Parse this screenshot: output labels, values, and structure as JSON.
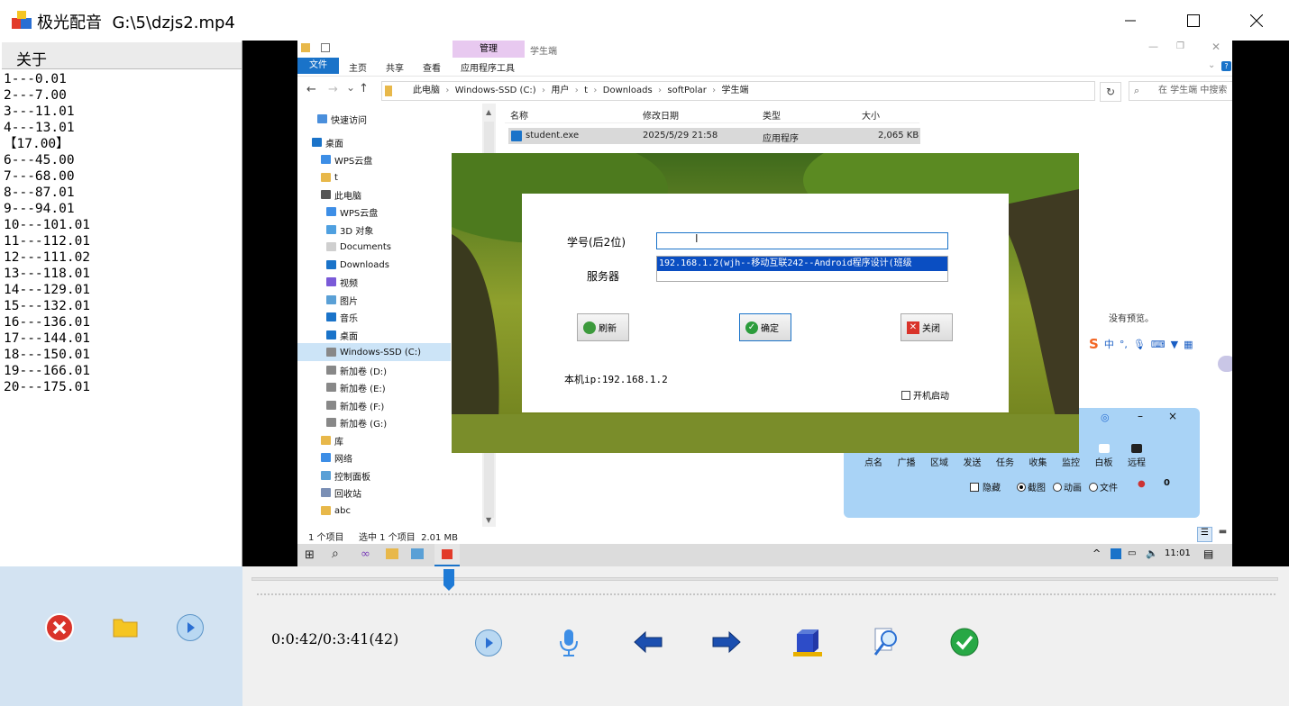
{
  "window": {
    "title": "极光配音  G:\\5\\dzjs2.mp4"
  },
  "menu": {
    "about": "关于"
  },
  "segments": [
    "1---0.01",
    "2---7.00",
    "3---11.01",
    "4---13.01",
    "【17.00】",
    "6---45.00",
    "7---68.00",
    "8---87.01",
    "9---94.01",
    "10---101.01",
    "11---112.01",
    "12---111.02",
    "13---118.01",
    "14---129.01",
    "15---132.01",
    "16---136.01",
    "17---144.01",
    "18---150.01",
    "19---166.01",
    "20---175.01"
  ],
  "explorer": {
    "ribbon": {
      "manage": "管理",
      "context_title": "学生端",
      "file": "文件",
      "home": "主页",
      "share": "共享",
      "view": "查看",
      "app_tools": "应用程序工具"
    },
    "path": [
      "此电脑",
      "Windows-SSD (C:)",
      "用户",
      "t",
      "Downloads",
      "softPolar",
      "学生端"
    ],
    "search_placeholder": "在 学生端 中搜索",
    "nav": [
      "快速访问",
      "桌面",
      "WPS云盘",
      "t",
      "此电脑",
      "WPS云盘",
      "3D 对象",
      "Documents",
      "Downloads",
      "视频",
      "图片",
      "音乐",
      "桌面",
      "Windows-SSD (C:)",
      "新加卷 (D:)",
      "新加卷 (E:)",
      "新加卷 (F:)",
      "新加卷 (G:)",
      "库",
      "网络",
      "控制面板",
      "回收站",
      "abc"
    ],
    "columns": [
      "名称",
      "修改日期",
      "类型",
      "大小"
    ],
    "files": [
      {
        "name": "student.exe",
        "date": "2025/5/29 21:58",
        "type": "应用程序",
        "size": "2,065 KB"
      }
    ],
    "status_count": "1 个项目",
    "status_selected": "选中 1 个项目  2.01 MB",
    "no_preview": "没有预览。"
  },
  "login_dialog": {
    "id_label": "学号(后2位)",
    "id_value": "",
    "server_label": "服务器",
    "server_value": "192.168.1.2(wjh--移动互联242--Android程序设计(班级",
    "refresh": "刷新",
    "confirm": "确定",
    "close": "关闭",
    "local_ip": "本机ip:192.168.1.2",
    "autostart": "开机启动"
  },
  "control_panel": {
    "buttons": [
      "点名",
      "广播",
      "区域",
      "发送",
      "任务",
      "收集",
      "监控",
      "白板",
      "远程"
    ],
    "hide": "隐藏",
    "radio": [
      "截图",
      "动画",
      "文件"
    ],
    "count": "0"
  },
  "ime": {
    "mode": "中",
    "punct": "°,"
  },
  "taskbar": {
    "clock": "11:01"
  },
  "playback": {
    "time": "0:0:42/0:3:41(42)",
    "progress": 0.192
  },
  "colors": {
    "accent": "#1a73c9",
    "panel_blue": "#d3e3f2",
    "slider_blue": "#1e7ad6"
  },
  "icons": {
    "bottom_left": [
      "delete-icon",
      "folder-icon",
      "play-icon"
    ],
    "toolbar": [
      "play-icon",
      "microphone-icon",
      "arrow-left-icon",
      "arrow-right-icon",
      "export-icon",
      "search-icon",
      "check-icon"
    ]
  }
}
